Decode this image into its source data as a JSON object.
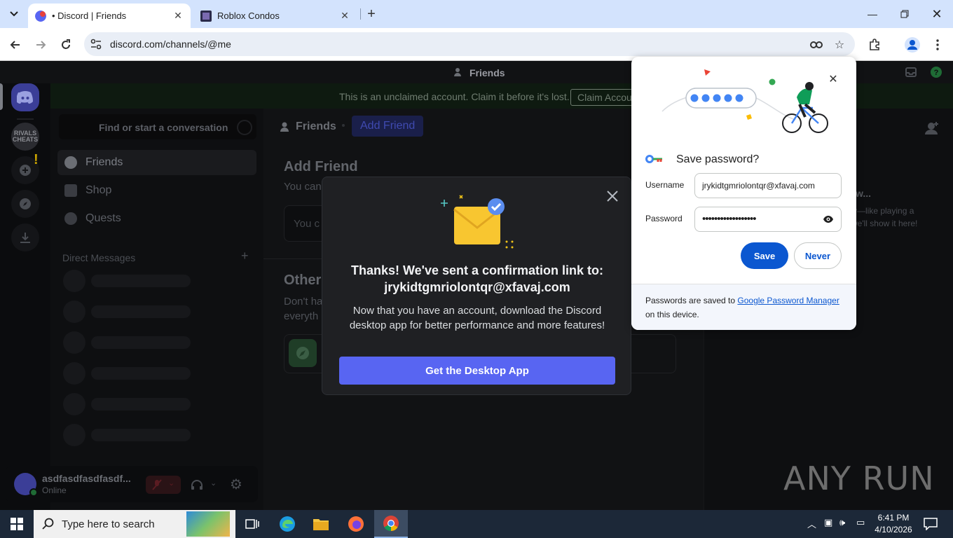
{
  "browser": {
    "tabs": [
      {
        "title": "• Discord | Friends",
        "active": true
      },
      {
        "title": "Roblox Condos",
        "active": false
      }
    ],
    "url": "discord.com/channels/@me"
  },
  "discord": {
    "window_title": "Friends",
    "banner_text": "This is an unclaimed account. Claim it before it's lost.",
    "banner_button": "Claim Accou",
    "search_placeholder": "Find or start a conversation",
    "nav": {
      "friends": "Friends",
      "shop": "Shop",
      "quests": "Quests"
    },
    "direct_messages": "Direct Messages",
    "server_label": "RIVALS CHEATS",
    "header": {
      "friends": "Friends",
      "add_friend": "Add Friend"
    },
    "add_friend_title": "Add Friend",
    "add_friend_sub": "You can",
    "input_placeholder": "You c",
    "other_title": "Other",
    "other_text_1": "Don't ha",
    "other_text_2": "everyth",
    "active_now_title": "w...",
    "active_now_text_1": "y—like playing a",
    "active_now_text_2": "we'll show it here!",
    "user": {
      "name": "asdfasdfasdfasdf...",
      "status": "Online"
    }
  },
  "modal": {
    "heading_line1": "Thanks! We've sent a confirmation link to:",
    "heading_line2": "jrykidtgmriolontqr@xfavaj.com",
    "body_line1": "Now that you have an account, download the Discord",
    "body_line2": "desktop app for better performance and more features!",
    "cta": "Get the Desktop App"
  },
  "password_bubble": {
    "title": "Save password?",
    "username_label": "Username",
    "username_value": "jrykidtgmriolontqr@xfavaj.com",
    "password_label": "Password",
    "password_value": "••••••••••••••••••",
    "save": "Save",
    "never": "Never",
    "footer_pre": "Passwords are saved to ",
    "footer_link": "Google Password Manager",
    "footer_post": "on this device."
  },
  "watermark": "ANY RUN",
  "taskbar": {
    "search_placeholder": "Type here to search",
    "time": "6:41 PM",
    "date": "4/10/2026"
  },
  "colors": {
    "discord_blurple": "#5865f2",
    "chrome_blue": "#0b57d0",
    "tabstrip": "#d3e3fd"
  }
}
